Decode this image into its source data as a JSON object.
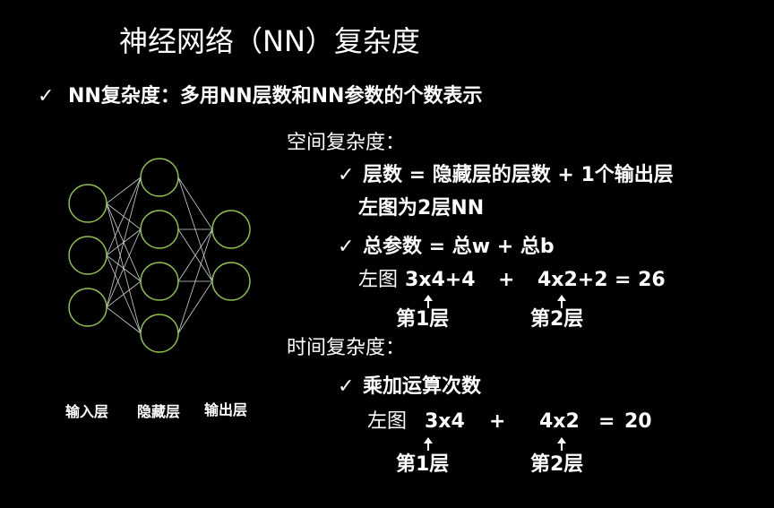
{
  "title": "神经网络（NN）复杂度",
  "bullet_main": {
    "check": "✓",
    "text": "NN复杂度：多用NN层数和NN参数的个数表示"
  },
  "space": {
    "heading": "空间复杂度：",
    "item1": {
      "check": "✓",
      "text": "层数 = 隐藏层的层数 + 1个输出层"
    },
    "item1_sub": "左图为2层NN",
    "item2": {
      "check": "✓",
      "text": "总参数 = 总w + 总b"
    },
    "formula": {
      "prefix": "左图",
      "term1": "3x4+4",
      "plus": "+",
      "term2": "4x2+2",
      "result": "= 26"
    },
    "layer1": "第1层",
    "layer2": "第2层"
  },
  "time": {
    "heading": "时间复杂度：",
    "item1": {
      "check": "✓",
      "text": "乘加运算次数"
    },
    "formula": {
      "prefix": "左图",
      "term1": "3x4",
      "plus": "+",
      "term2": "4x2",
      "eq": "=",
      "result": "20"
    },
    "layer1": "第1层",
    "layer2": "第2层"
  },
  "network": {
    "layers": [
      {
        "label": "输入层",
        "nodes": 3
      },
      {
        "label": "隐藏层",
        "nodes": 4
      },
      {
        "label": "输出层",
        "nodes": 2
      }
    ],
    "node_color": "#8fc04a",
    "edge_color": "#d0d0d0"
  }
}
